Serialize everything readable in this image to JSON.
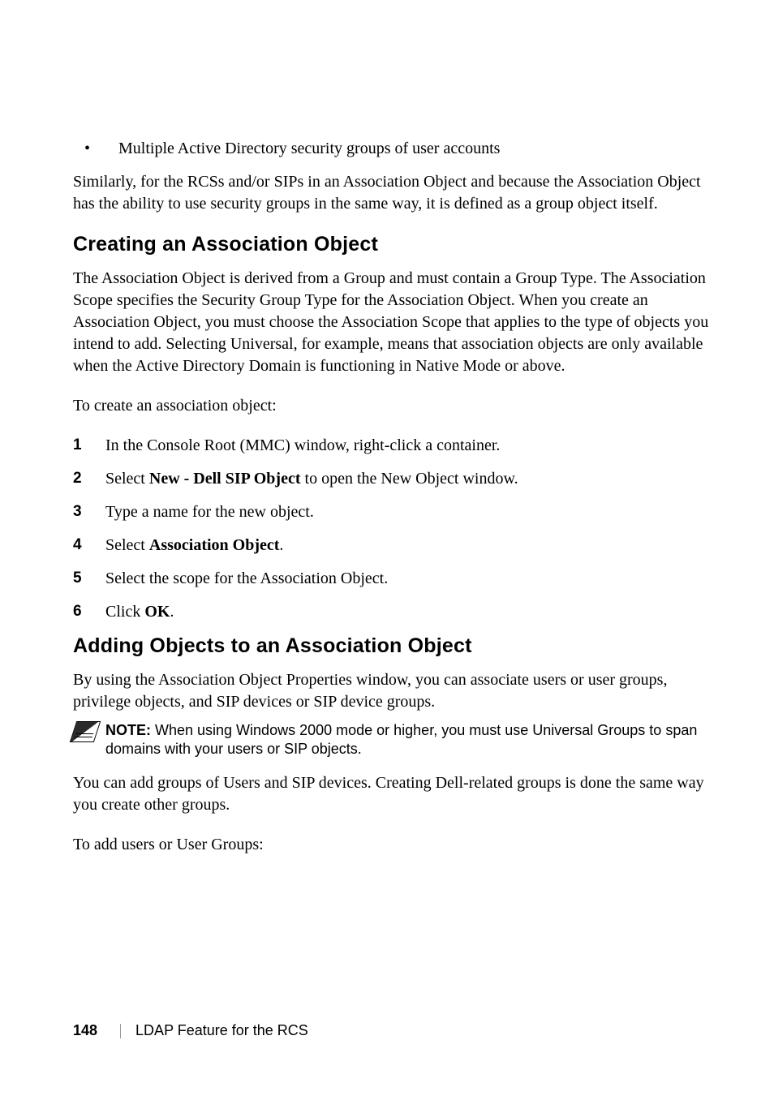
{
  "bullet": {
    "items": [
      {
        "text": "Multiple Active Directory security groups of user accounts"
      }
    ]
  },
  "intro_para": "Similarly, for the RCSs and/or SIPs in an Association Object and because the Association Object has the ability to use security groups in the same way, it is defined as a group object itself.",
  "section1": {
    "heading": "Creating an Association Object",
    "para": "The Association Object is derived from a Group and must contain a Group Type. The Association Scope specifies the Security Group Type for the Association Object. When you create an Association Object, you must choose the Association Scope that applies to the type of objects you intend to add. Selecting Universal, for example, means that association objects are only available when the Active Directory Domain is functioning in Native Mode or above.",
    "lead_in": "To create an association object:",
    "steps": [
      {
        "num": "1",
        "pre": "In the Console Root (MMC) window, right-click a container.",
        "bold": "",
        "post": ""
      },
      {
        "num": "2",
        "pre": "Select ",
        "bold": "New - Dell SIP Object",
        "post": " to open the New Object window."
      },
      {
        "num": "3",
        "pre": "Type a name for the new object.",
        "bold": "",
        "post": ""
      },
      {
        "num": "4",
        "pre": "Select ",
        "bold": "Association Object",
        "post": "."
      },
      {
        "num": "5",
        "pre": "Select the scope for the Association Object.",
        "bold": "",
        "post": ""
      },
      {
        "num": "6",
        "pre": "Click ",
        "bold": "OK",
        "post": "."
      }
    ]
  },
  "section2": {
    "heading": "Adding Objects to an Association Object",
    "para": "By using the Association Object Properties window, you can associate users or user groups, privilege objects, and SIP devices or SIP device groups.",
    "note_label": "NOTE: ",
    "note_text": "When using Windows 2000 mode or higher, you must use Universal Groups to span domains with your users or SIP objects.",
    "para2": "You can add groups of Users and SIP devices. Creating Dell-related groups is done the same way you create other groups.",
    "lead_in": "To add users or User Groups:"
  },
  "footer": {
    "page": "148",
    "title": "LDAP Feature for the RCS"
  }
}
